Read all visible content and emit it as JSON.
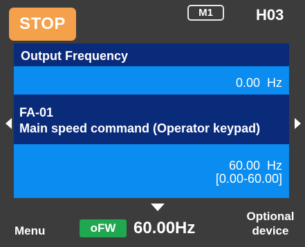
{
  "status": {
    "state_label": "STOP",
    "monitor_badge": "M1",
    "screen_code": "H03",
    "colors": {
      "stop_badge": "#f5a04a",
      "accent": "#0a8cf0",
      "dark_band": "#0a2a7a",
      "direction_badge": "#1fa84f"
    }
  },
  "monitor": {
    "title": "Output Frequency",
    "value": "0.00  Hz"
  },
  "parameter": {
    "code": "FA-01",
    "name": "Main speed command (Operator keypad)",
    "value": "60.00  Hz",
    "range": "[0.00-60.00]",
    "nav_icons": [
      "chevron-left-icon",
      "chevron-right-icon",
      "chevron-down-icon"
    ]
  },
  "footer": {
    "menu_label": "Menu",
    "direction_label": "oFW",
    "frequency": "60.00Hz",
    "optional_line1": "Optional",
    "optional_line2": "device"
  }
}
